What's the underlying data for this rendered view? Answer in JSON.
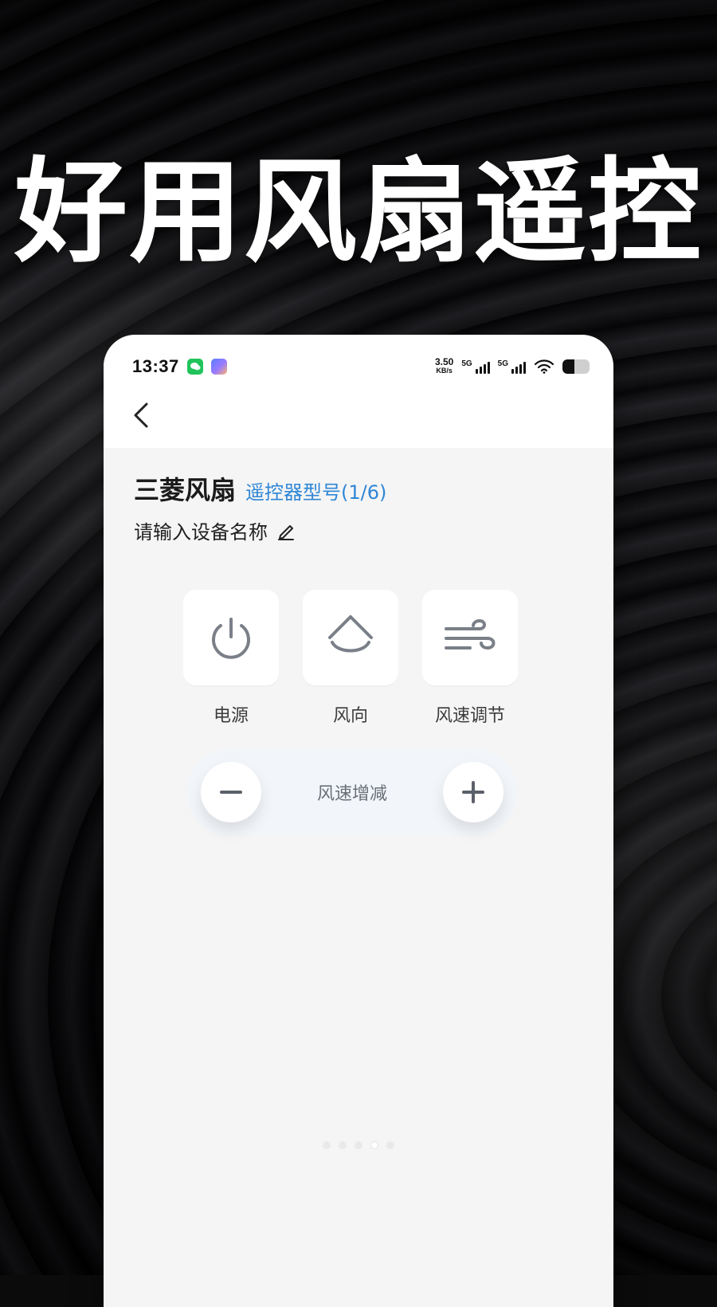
{
  "banner": {
    "headline": "好用风扇遥控"
  },
  "status_bar": {
    "time": "13:37",
    "net_speed_value": "3.50",
    "net_speed_unit": "KB/s",
    "network_1": "5G",
    "network_2": "5G",
    "battery_level": 45
  },
  "screen": {
    "device_name": "三菱风扇",
    "model_label": "遥控器型号(1/6)",
    "name_placeholder": "请输入设备名称"
  },
  "controls": {
    "power_label": "电源",
    "direction_label": "风向",
    "speed_label": "风速调节",
    "speed_adjust_label": "风速增减"
  },
  "pager": {
    "count": 5,
    "active_index": 3
  }
}
